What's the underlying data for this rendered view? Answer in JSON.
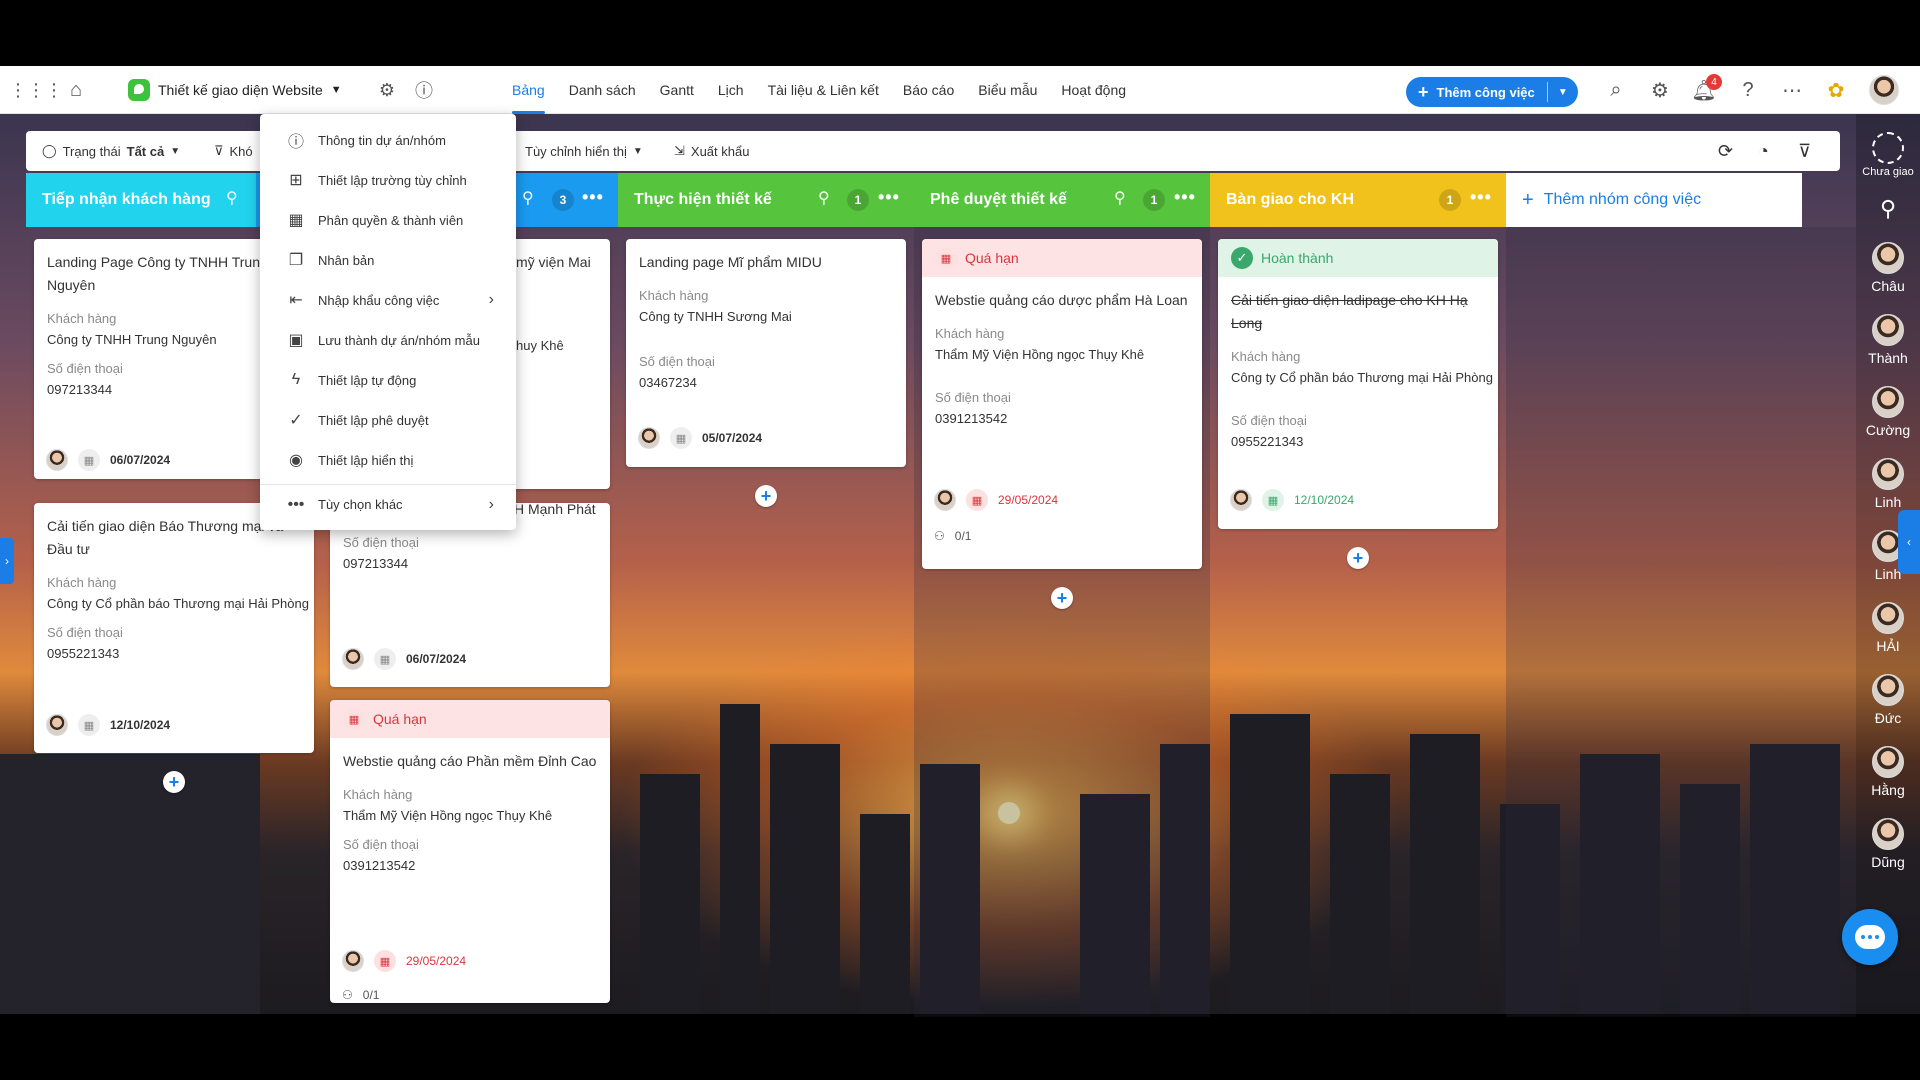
{
  "topbar": {
    "project_name": "Thiết kế giao diện Website",
    "tabs": [
      "Bảng",
      "Danh sách",
      "Gantt",
      "Lịch",
      "Tài liệu & Liên kết",
      "Báo cáo",
      "Biểu mẫu",
      "Hoạt động"
    ],
    "active_tab": "Bảng",
    "add_button_label": "Thêm công việc",
    "notification_count": "4"
  },
  "filterbar": {
    "status_label": "Trạng thái",
    "status_value": "Tất cả",
    "filter2_label": "Khó",
    "display_label": "Tùy chỉnh hiển thị",
    "export_label": "Xuất khẩu"
  },
  "menu": {
    "items": [
      {
        "label": "Thông tin dự án/nhóm",
        "icon": "info-icon"
      },
      {
        "label": "Thiết lập trường tùy chỉnh",
        "icon": "custom-field-icon"
      },
      {
        "label": "Phân quyền & thành viên",
        "icon": "permissions-icon"
      },
      {
        "label": "Nhân bản",
        "icon": "duplicate-icon"
      },
      {
        "label": "Nhập khẩu công việc",
        "icon": "import-icon"
      },
      {
        "label": "Lưu thành dự án/nhóm mẫu",
        "icon": "save-template-icon"
      },
      {
        "label": "Thiết lập tự động",
        "icon": "automation-icon"
      },
      {
        "label": "Thiết lập phê duyệt",
        "icon": "approval-icon"
      },
      {
        "label": "Thiết lập hiển thị",
        "icon": "eye-icon"
      },
      {
        "label": "Tùy chọn khác",
        "icon": "more-icon"
      }
    ]
  },
  "columns": [
    {
      "title": "Tiếp nhận khách hàng",
      "color": "#22d3ee",
      "count": ""
    },
    {
      "title": "",
      "color": "#1a9bf0",
      "count": "3"
    },
    {
      "title": "Thực hiện thiết kế",
      "color": "#56c43c",
      "count": "1"
    },
    {
      "title": "Phê duyệt thiết kế",
      "color": "#56c43c",
      "count": "1"
    },
    {
      "title": "Bàn giao cho KH",
      "color": "#f2c21c",
      "count": "1"
    }
  ],
  "add_group_label": "Thêm nhóm công việc",
  "labels": {
    "customer": "Khách hàng",
    "phone": "Số điện thoại",
    "overdue": "Quá hạn",
    "done": "Hoàn thành"
  },
  "cards": {
    "c1": {
      "title": "Landing Page Công ty TNHH Trung Nguyên",
      "customer": "Công ty TNHH Trung Nguyên",
      "phone": "097213344",
      "date": "06/07/2024"
    },
    "c2": {
      "title": "Cải tiến giao diện Báo Thương mại và Đầu tư",
      "customer": "Công ty Cổ phần báo Thương mại Hải Phòng",
      "phone": "0955221343",
      "date": "12/10/2024"
    },
    "c3": {
      "title_tail": "mỹ viện Mai",
      "customer_tail": "huy Khê"
    },
    "c4": {
      "title": "Landing Page Công ty TNHH Mạnh Phát",
      "phone": "097213344",
      "date": "06/07/2024"
    },
    "c5": {
      "title": "Webstie quảng cáo Phần mềm Đỉnh Cao",
      "customer": "Thẩm Mỹ Viện Hồng ngọc Thụy Khê",
      "phone": "0391213542",
      "date": "29/05/2024",
      "sub": "0/1"
    },
    "c6": {
      "title": "Landing page Mĩ phẩm MIDU",
      "customer": "Công ty TNHH Sương Mai",
      "phone": "03467234",
      "date": "05/07/2024"
    },
    "c7": {
      "title": "Webstie quảng cáo dược phẩm Hà Loan",
      "customer": "Thẩm Mỹ Viện Hồng ngọc Thụy Khê",
      "phone": "0391213542",
      "date": "29/05/2024",
      "sub": "0/1"
    },
    "c8": {
      "title": "Cải tiến giao diện ladipage cho KH Hạ Long",
      "customer": "Công ty Cổ phần báo Thương mại Hải Phòng",
      "phone": "0955221343",
      "date": "12/10/2024"
    }
  },
  "sidebar": {
    "unassigned_label": "Chưa giao",
    "users": [
      "Châu",
      "Thành",
      "Cường",
      "Linh",
      "Linh",
      "HẢI",
      "Đức",
      "Hằng",
      "Dũng"
    ]
  }
}
